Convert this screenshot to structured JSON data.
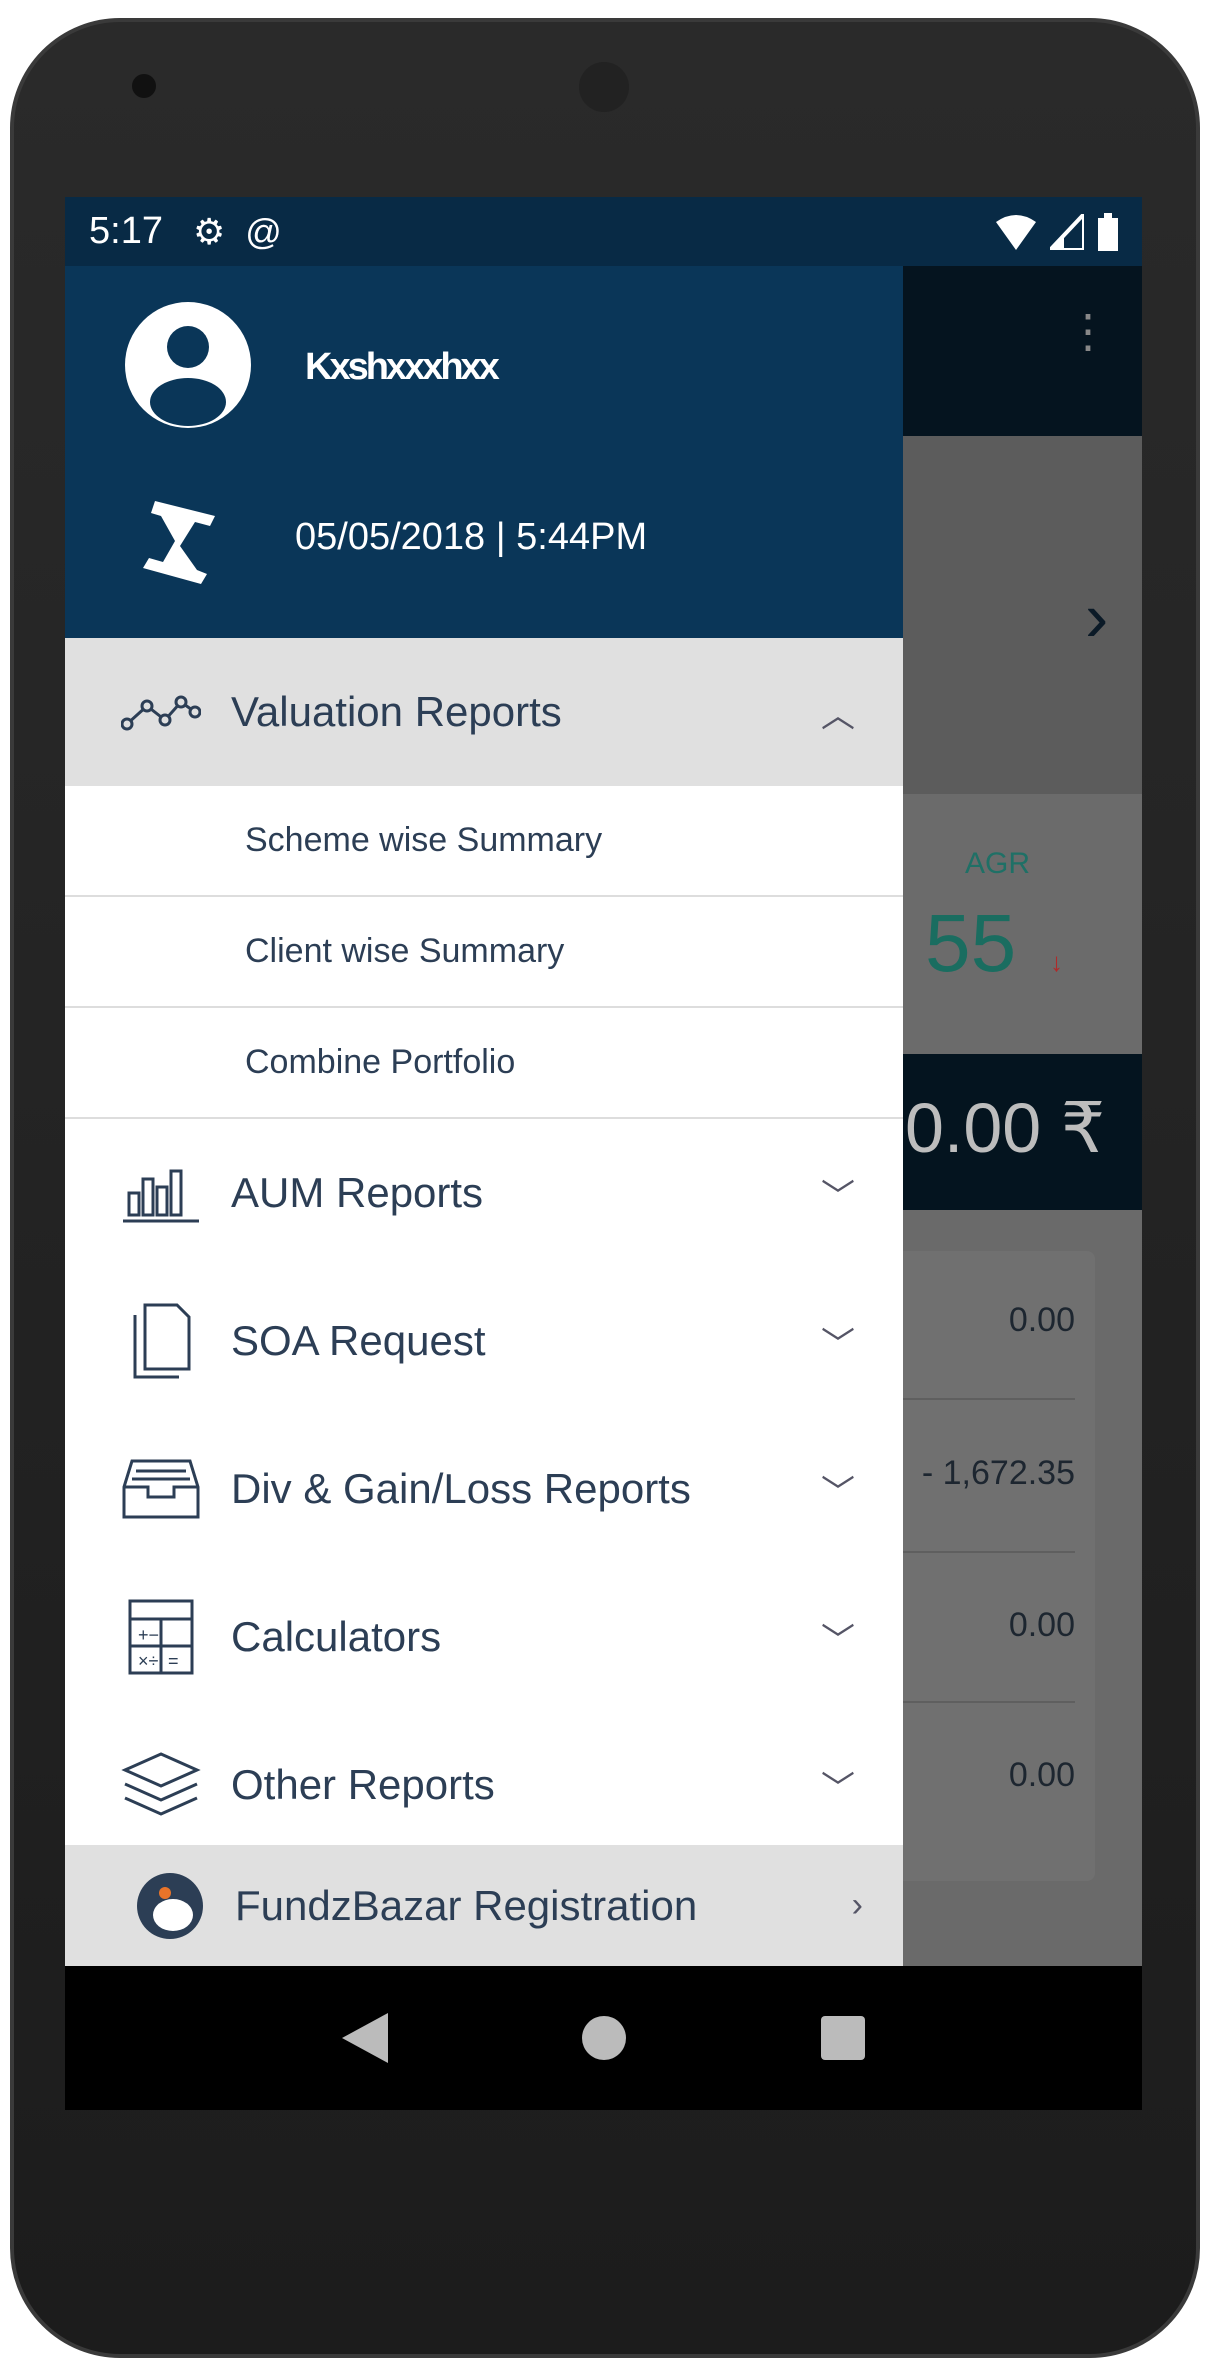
{
  "status_bar": {
    "time": "5:17",
    "icons": [
      "gear-icon",
      "sync-icon",
      "wifi-icon",
      "signal-icon",
      "battery-icon"
    ]
  },
  "drawer": {
    "user_name": "Kxshxxxhxx",
    "last_login": "05/05/2018 | 5:44PM",
    "menu": [
      {
        "label": "Valuation Reports",
        "icon": "line-chart-icon",
        "expanded": true,
        "sub": [
          "Scheme wise Summary",
          "Client wise Summary",
          "Combine Portfolio"
        ]
      },
      {
        "label": "AUM Reports",
        "icon": "bar-chart-icon"
      },
      {
        "label": "SOA Request",
        "icon": "document-icon"
      },
      {
        "label": "Div & Gain/Loss Reports",
        "icon": "inbox-tray-icon"
      },
      {
        "label": "Calculators",
        "icon": "calculator-icon"
      },
      {
        "label": "Other Reports",
        "icon": "layers-icon"
      }
    ],
    "footer": {
      "label": "FundzBazar Registration",
      "icon": "fundzbazar-logo"
    }
  },
  "background": {
    "cagr_label": "AGR",
    "cagr_value": "55",
    "total": "0.00 ₹",
    "rows": [
      "0.00",
      "- 1,672.35",
      "0.00",
      "0.00"
    ]
  },
  "colors": {
    "header": "#0a3658",
    "status": "#082a45",
    "text": "#2c3e55",
    "selected": "#e0e0e0",
    "cagr": "#1a6d60"
  }
}
